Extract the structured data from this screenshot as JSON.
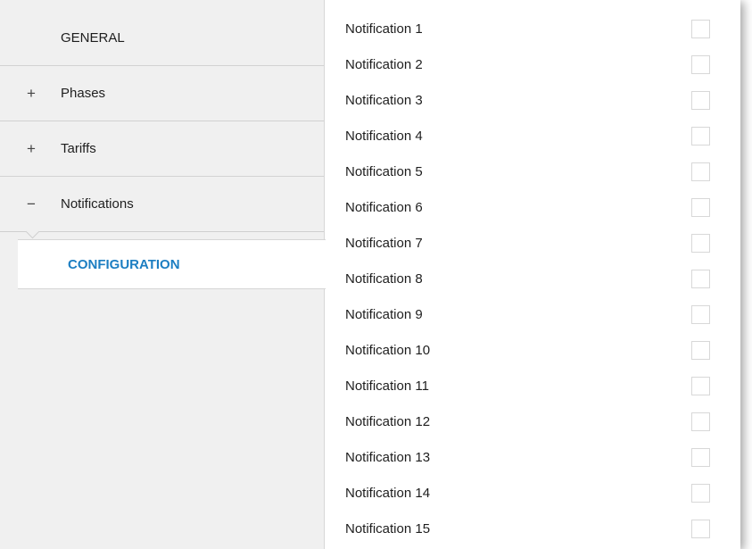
{
  "sidebar": {
    "items": [
      {
        "sign": "",
        "label": "GENERAL"
      },
      {
        "sign": "+",
        "label": "Phases"
      },
      {
        "sign": "+",
        "label": "Tariffs"
      },
      {
        "sign": "−",
        "label": "Notifications"
      }
    ],
    "sub_item": {
      "label": "CONFIGURATION"
    }
  },
  "notifications": [
    {
      "label": "Notification 1",
      "checked": false
    },
    {
      "label": "Notification 2",
      "checked": false
    },
    {
      "label": "Notification 3",
      "checked": false
    },
    {
      "label": "Notification 4",
      "checked": false
    },
    {
      "label": "Notification 5",
      "checked": false
    },
    {
      "label": "Notification 6",
      "checked": false
    },
    {
      "label": "Notification 7",
      "checked": false
    },
    {
      "label": "Notification 8",
      "checked": false
    },
    {
      "label": "Notification 9",
      "checked": false
    },
    {
      "label": "Notification 10",
      "checked": false
    },
    {
      "label": "Notification 11",
      "checked": false
    },
    {
      "label": "Notification 12",
      "checked": false
    },
    {
      "label": "Notification 13",
      "checked": false
    },
    {
      "label": "Notification 14",
      "checked": false
    },
    {
      "label": "Notification 15",
      "checked": false
    }
  ],
  "colors": {
    "accent": "#1c7ec2",
    "sidebar_bg": "#f0f0f0"
  }
}
